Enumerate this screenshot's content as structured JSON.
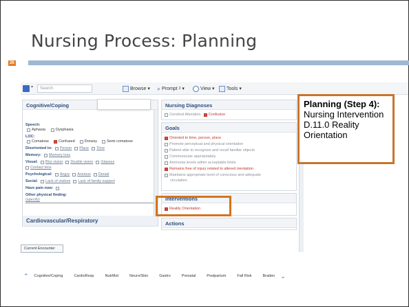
{
  "slide": {
    "title": "Nursing Process: Planning",
    "number": "26"
  },
  "toolbar": {
    "search_placeholder": "Search",
    "browse": "Browse",
    "prompt": "Prompt",
    "prompt_count": "2",
    "view": "View",
    "tools": "Tools"
  },
  "cognitive": {
    "header": "Cognitive/Coping",
    "speech_label": "Speech:",
    "speech_opts": [
      "Aphasia",
      "Dysphasia"
    ],
    "loc_label": "LOC:",
    "loc_opts": [
      "Comatose",
      "Confused",
      "Drowsy",
      "Semi comatose"
    ],
    "disoriented_label": "Disoriented to:",
    "disoriented_opts": [
      "Person",
      "Place",
      "Time"
    ],
    "memory_label": "Memory:",
    "memory_opt": "Memory loss",
    "visual_label": "Visual:",
    "visual_opts": [
      "Blur vision",
      "Double vision",
      "Glasses"
    ],
    "contact_lens": "Contact lens",
    "psych_label": "Psychological:",
    "psych_opts": [
      "Angry",
      "Anxious",
      "Denial"
    ],
    "social_label": "Social:",
    "social_opts": [
      "Lack of visitors",
      "Lack of family support"
    ],
    "pain_label": "Have pain now:",
    "other_label": "Other physical finding:",
    "specify": "(specify)",
    "cardio_header": "Cardiovascular/Respiratory"
  },
  "diagnoses": {
    "header": "Nursing Diagnoses",
    "opts": [
      "Cerebral Alteration",
      "Confusion"
    ]
  },
  "goals": {
    "header": "Goals",
    "items": [
      {
        "text": "Oriented to time, person, place",
        "checked": true
      },
      {
        "text": "Promote perceptual and physical orientation",
        "checked": false
      },
      {
        "text": "Patient able to recognize and recall familiar objects",
        "checked": false
      },
      {
        "text": "Communicate appropriately",
        "checked": false
      },
      {
        "text": "Ammonia levels within acceptable limits",
        "checked": false
      },
      {
        "text": "Remains free of injury related to altered mentation",
        "checked": true
      },
      {
        "text": "Maintains appropriate level of conscious and adequate",
        "checked": false
      }
    ],
    "circulation": "circulation"
  },
  "interventions": {
    "header": "Interventions",
    "item": "Reality Orientation"
  },
  "actions": {
    "header": "Actions"
  },
  "callout": {
    "bold": "Planning (Step 4):",
    "rest": " Nursing Intervention D.11.0 Reality Orientation"
  },
  "encounter_btn": "Current Encounter",
  "nav_tabs": [
    "Cognitive/Coping",
    "CardioResp",
    "NutrMet",
    "Neuro/Skin",
    "Gastro",
    "Prenatal",
    "Postpartum",
    "Fall Risk",
    "Braden"
  ],
  "colors": {
    "accent_orange": "#d3741e",
    "header_blue": "#2c4c7c",
    "slide_rule": "#9eb8d3"
  }
}
